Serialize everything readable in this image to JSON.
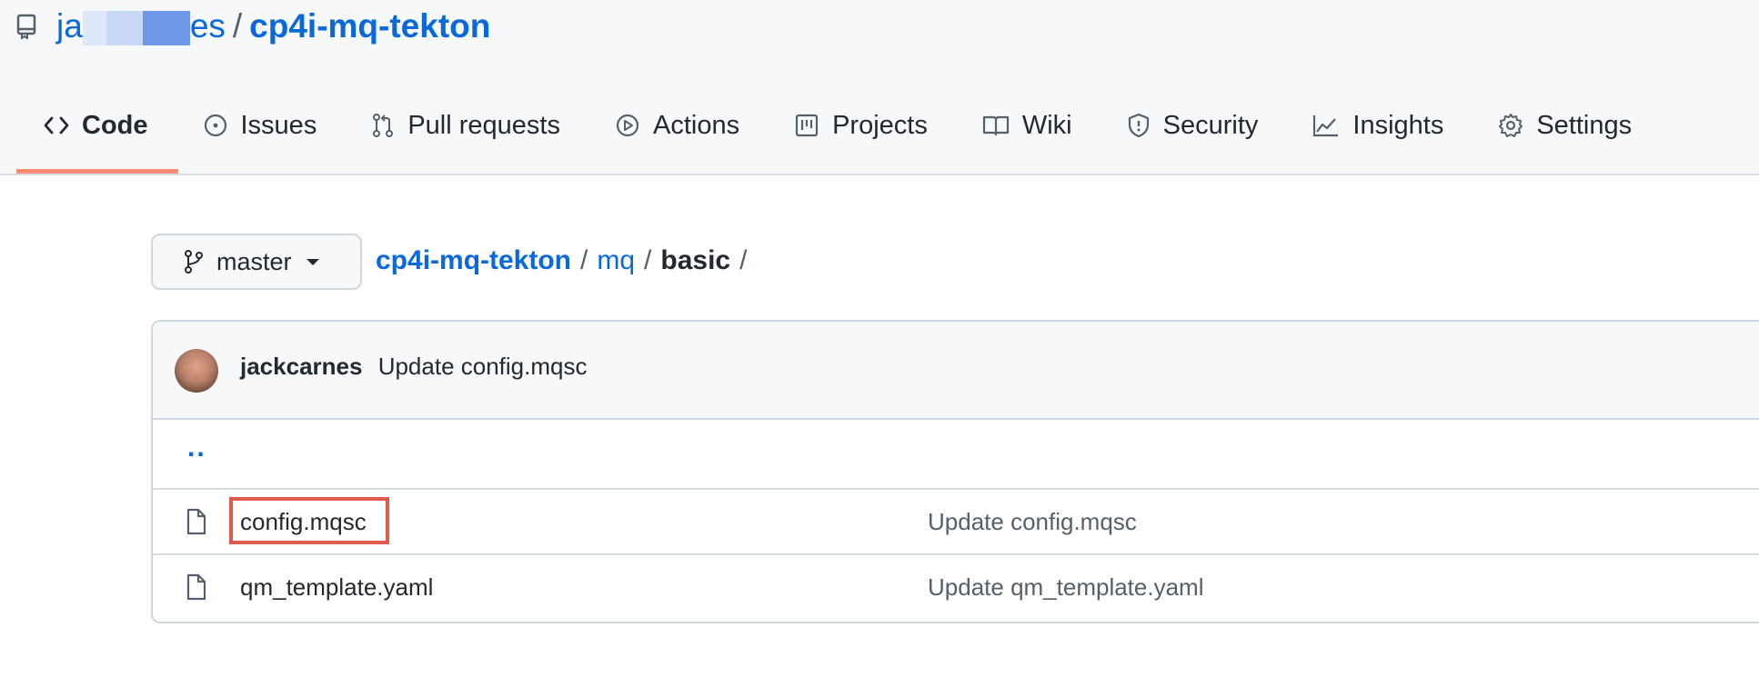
{
  "repo": {
    "owner": "ja  es",
    "owner_prefix": "ja",
    "owner_suffix": "es",
    "separator": "/",
    "name": "cp4i-mq-tekton"
  },
  "tabs": [
    {
      "label": "Code",
      "icon": "code-icon",
      "selected": true
    },
    {
      "label": "Issues",
      "icon": "issue-icon"
    },
    {
      "label": "Pull requests",
      "icon": "pull-request-icon"
    },
    {
      "label": "Actions",
      "icon": "play-icon"
    },
    {
      "label": "Projects",
      "icon": "project-icon"
    },
    {
      "label": "Wiki",
      "icon": "book-icon"
    },
    {
      "label": "Security",
      "icon": "shield-icon"
    },
    {
      "label": "Insights",
      "icon": "graph-icon"
    },
    {
      "label": "Settings",
      "icon": "gear-icon"
    }
  ],
  "branch": {
    "label": "master",
    "icon": "git-branch-icon"
  },
  "breadcrumb": {
    "root": "cp4i-mq-tekton",
    "sep": "/",
    "segments": [
      "mq"
    ],
    "current": "basic",
    "trailing": "/"
  },
  "latest_commit": {
    "author": "jackcarnes",
    "message": "Update config.mqsc"
  },
  "parent_dir": "..",
  "files": [
    {
      "name": "config.mqsc",
      "commit_message": "Update config.mqsc",
      "highlighted": true
    },
    {
      "name": "qm_template.yaml",
      "commit_message": "Update qm_template.yaml",
      "highlighted": false
    }
  ],
  "colors": {
    "link": "#0969da",
    "tab_underline": "#fd8c73",
    "highlight_box": "#e05a4b",
    "redaction": "#c9d8f7"
  }
}
